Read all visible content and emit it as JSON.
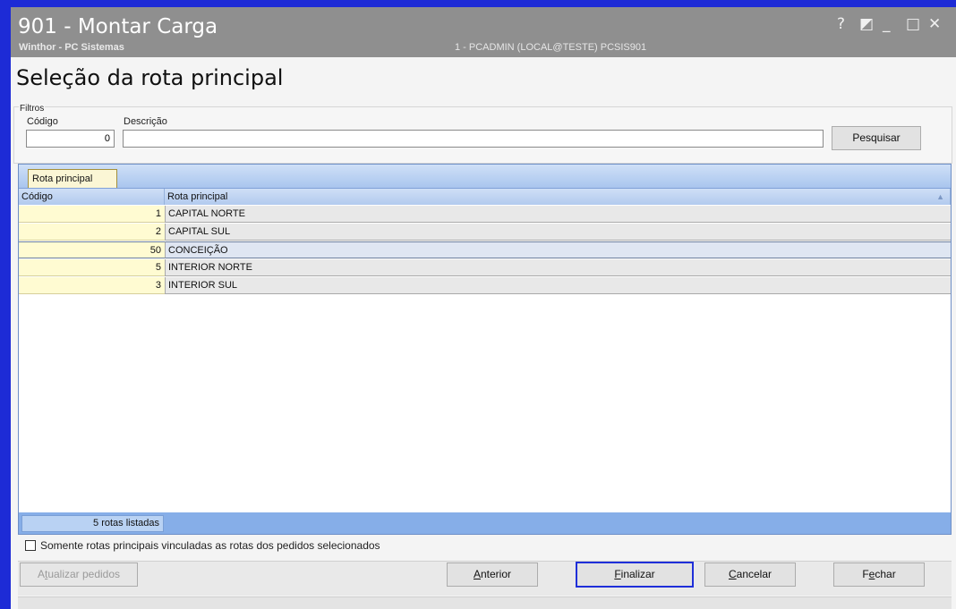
{
  "window": {
    "title": "901 - Montar Carga",
    "company": "Winthor - PC Sistemas",
    "session": "1 - PCADMIN (LOCAL@TESTE)  PCSIS901",
    "controls": {
      "help": "?",
      "restore": "◩",
      "minimize": "_",
      "maximize": "□",
      "close": "✕"
    }
  },
  "page": {
    "heading": "Seleção da rota principal"
  },
  "filters": {
    "group_label": "Filtros",
    "code_label": "Código",
    "code_value": "0",
    "desc_label": "Descrição",
    "desc_value": "",
    "search_button": "Pesquisar"
  },
  "grid": {
    "tab_label": "Rota principal",
    "columns": [
      "Código",
      "Rota principal"
    ],
    "sort_indicator": "▲",
    "rows": [
      {
        "code": "1",
        "name": "CAPITAL NORTE"
      },
      {
        "code": "2",
        "name": "CAPITAL SUL"
      },
      {
        "code": "50",
        "name": "CONCEIÇÃO"
      },
      {
        "code": "5",
        "name": "INTERIOR NORTE"
      },
      {
        "code": "3",
        "name": "INTERIOR SUL"
      }
    ],
    "selected_row": 2,
    "footer_count": "5 rotas listadas"
  },
  "options": {
    "only_linked_label": "Somente rotas principais vinculadas as rotas dos pedidos selecionados",
    "only_linked_checked": false
  },
  "buttons": {
    "update": {
      "pre": "A",
      "key": "t",
      "post": "ualizar pedidos"
    },
    "previous": {
      "pre": "",
      "key": "A",
      "post": "nterior"
    },
    "finish": {
      "pre": "",
      "key": "F",
      "post": "inalizar"
    },
    "cancel": {
      "pre": "",
      "key": "C",
      "post": "ancelar"
    },
    "close": {
      "pre": "F",
      "key": "e",
      "post": "char"
    }
  },
  "colors": {
    "frame_border": "#1d2bd6",
    "titlebar": "#8f8f8f",
    "grid_header": "#b2caee",
    "code_cell": "#fffbd2",
    "footer": "#86aee8",
    "focus_border": "#1f2fd9"
  }
}
